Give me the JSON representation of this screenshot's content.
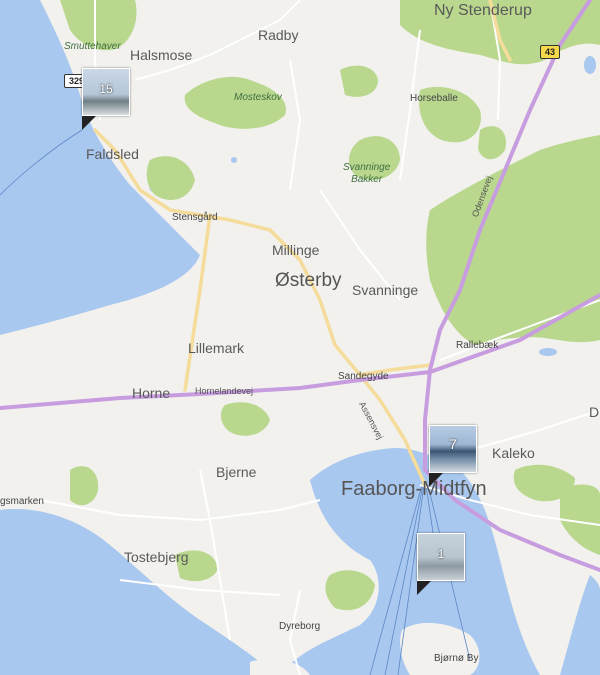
{
  "labels": {
    "ny_stenderup": "Ny Stenderup",
    "radby": "Radby",
    "smuttehaver": "Smuttehaver",
    "halsmose": "Halsmose",
    "mosteskov": "Mosteskov",
    "horseballe": "Horseballe",
    "faldsled": "Faldsled",
    "svanninge_bakker": "Svanninge\nBakker",
    "stensgard": "Stensgård",
    "odensevej": "Odensevej",
    "millinge": "Millinge",
    "osterby": "Østerby",
    "svanninge": "Svanninge",
    "rallebaek": "Rallebæk",
    "lillemark": "Lillemark",
    "sandegyde": "Sandegyde",
    "horne": "Horne",
    "hornelandevej": "Hornelandevej",
    "assensvej": "Assensvej",
    "kaleko": "Kaleko",
    "bjerne": "Bjerne",
    "faaborg_midtfyn": "Faaborg-Midtfyn",
    "gsmarken": "gsmarken",
    "tostebjerg": "Tostebjerg",
    "dyreborg": "Dyreborg",
    "bjorno_by": "Bjørnø By",
    "edge_d": "D"
  },
  "shields": {
    "road_329": "329",
    "road_43": "43"
  },
  "photo_clusters": [
    {
      "count": "15",
      "icon": "photo-thumbnail"
    },
    {
      "count": "7",
      "icon": "photo-thumbnail"
    },
    {
      "count": "1",
      "icon": "photo-thumbnail"
    }
  ],
  "colors": {
    "water": "#a9c8ef",
    "land": "#f2f1ee",
    "forest": "#b9d88e",
    "motorway": "#c79de0",
    "main_road": "#f5dc9a"
  }
}
